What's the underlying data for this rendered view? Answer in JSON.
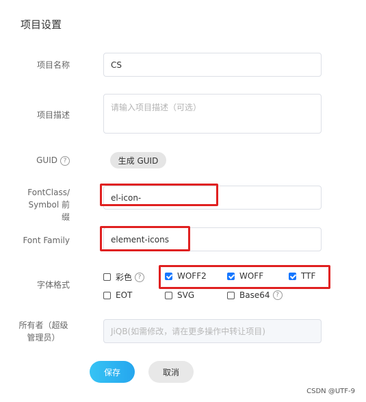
{
  "page_title": "项目设置",
  "fields": {
    "name": {
      "label": "项目名称",
      "value": "CS"
    },
    "description": {
      "label": "项目描述",
      "placeholder": "请输入项目描述（可选）"
    },
    "guid": {
      "label": "GUID",
      "help": "?",
      "button": "生成 GUID"
    },
    "fontclass": {
      "label_line1": "FontClass/",
      "label_line2": "Symbol 前缀",
      "value": "el-icon-"
    },
    "fontfamily": {
      "label": "Font Family",
      "value": "element-icons"
    },
    "formats": {
      "label": "字体格式",
      "options": [
        {
          "label": "彩色",
          "checked": false,
          "help": "?"
        },
        {
          "label": "WOFF2",
          "checked": true
        },
        {
          "label": "WOFF",
          "checked": true
        },
        {
          "label": "TTF",
          "checked": true
        },
        {
          "label": "EOT",
          "checked": false
        },
        {
          "label": "SVG",
          "checked": false
        },
        {
          "label": "Base64",
          "checked": false,
          "help": "?"
        }
      ]
    },
    "owner": {
      "label_line1": "所有者（超级",
      "label_line2": "管理员）",
      "placeholder": "JiQB(如需修改，请在更多操作中转让项目)"
    }
  },
  "actions": {
    "save": "保存",
    "cancel": "取消"
  },
  "watermark": "CSDN @UTF-9",
  "colors": {
    "accent": "#1677ff",
    "highlight": "#e02020",
    "save_gradient_start": "#37c3f4",
    "save_gradient_end": "#25a6ee"
  }
}
